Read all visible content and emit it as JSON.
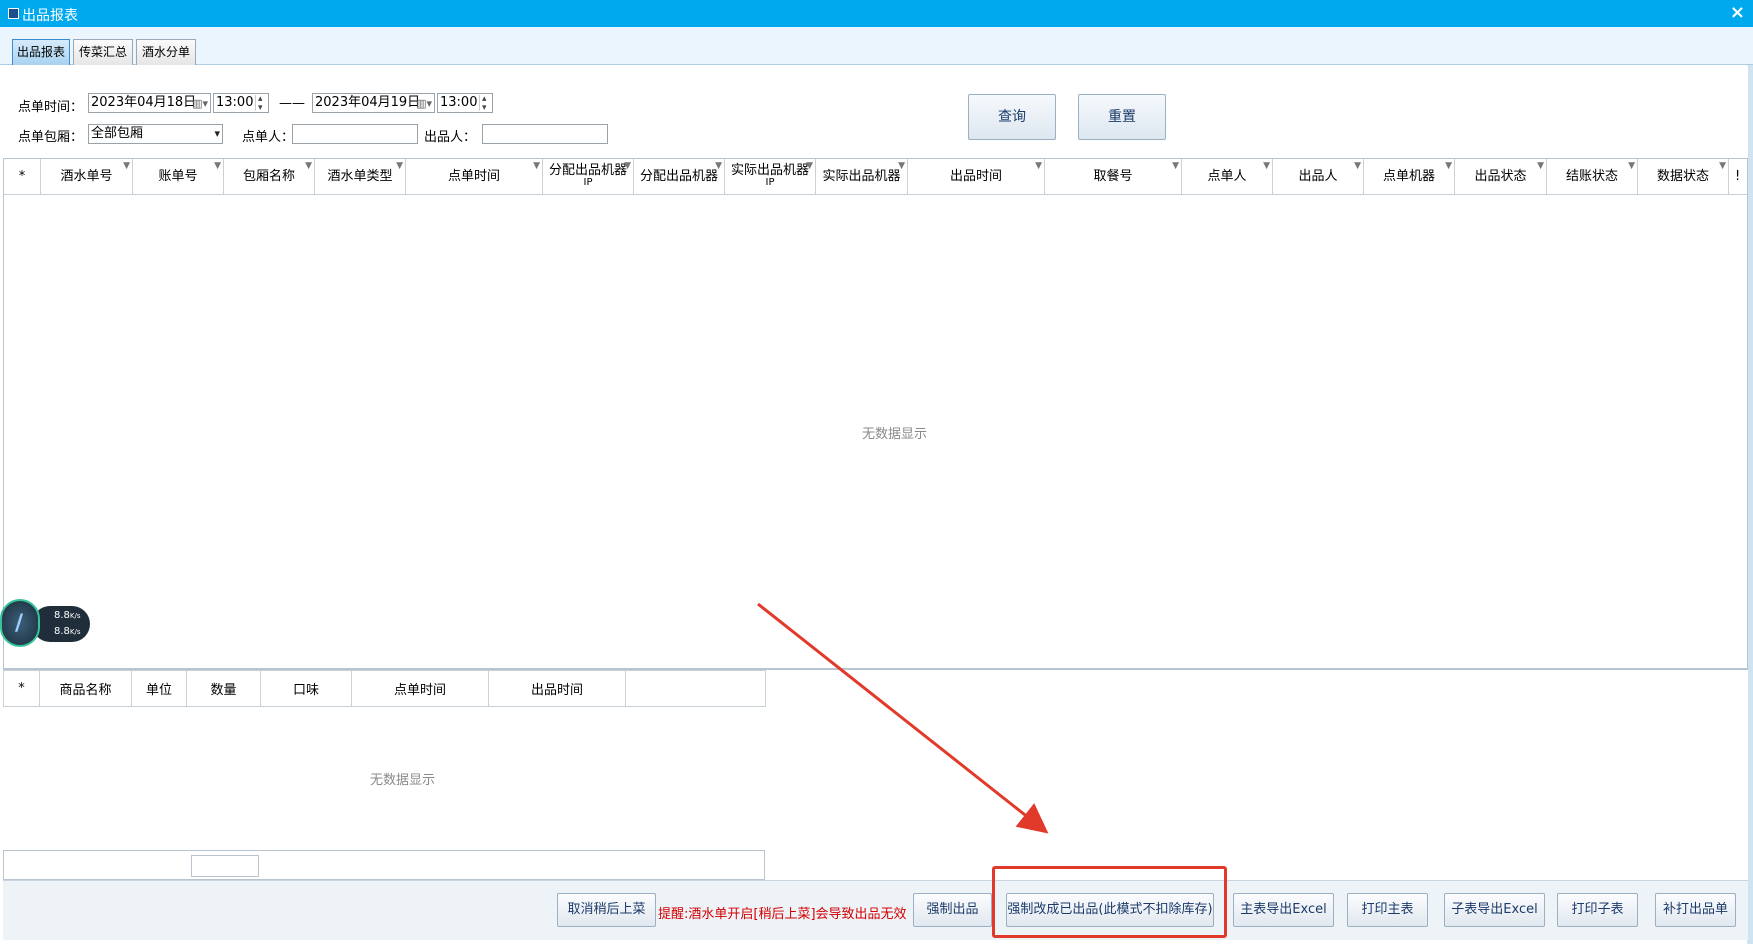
{
  "window": {
    "title": "出品报表",
    "close_glyph": "×"
  },
  "tabs": [
    "出品报表",
    "传菜汇总",
    "酒水分单"
  ],
  "filters": {
    "order_time_label": "点单时间：",
    "start_date": "2023年04月18日",
    "start_time": "13:00",
    "range_sep": "——",
    "end_date": "2023年04月19日",
    "end_time": "13:00",
    "room_label": "点单包厢：",
    "room_value": "全部包厢",
    "orderer_label": "点单人：",
    "orderer_value": "",
    "server_label": "出品人：",
    "server_value": "",
    "query_button": "查询",
    "reset_button": "重置"
  },
  "main_table": {
    "columns": [
      "*",
      "酒水单号",
      "账单号",
      "包厢名称",
      "酒水单类型",
      "点单时间",
      "分配出品机器IP",
      "分配出品机器",
      "实际出品机器IP",
      "实际出品机器",
      "出品时间",
      "取餐号",
      "点单人",
      "出品人",
      "点单机器",
      "出品状态",
      "结账状态",
      "数据状态",
      "!"
    ],
    "col_ip_top_1": "分配出品机器",
    "col_ip_top_2": "实际出品机器",
    "col_ip_bottom": "IP",
    "empty_text": "无数据显示"
  },
  "sub_table": {
    "columns": [
      "*",
      "商品名称",
      "单位",
      "数量",
      "口味",
      "点单时间",
      "出品时间"
    ],
    "empty_text": "无数据显示"
  },
  "speed_widget": {
    "up": "8.8",
    "down": "8.8",
    "unit": "K/s"
  },
  "bottom_bar": {
    "cancel_later": "取消稍后上菜",
    "warning": "提醒:酒水单开启[稍后上菜]会导致出品无效",
    "force_serve": "强制出品",
    "force_mark": "强制改成已出品(此模式不扣除库存)",
    "export_main": "主表导出Excel",
    "print_main": "打印主表",
    "export_sub": "子表导出Excel",
    "print_sub": "打印子表",
    "reprint": "补打出品单"
  },
  "annotation": {
    "color": "#e23a2a"
  }
}
